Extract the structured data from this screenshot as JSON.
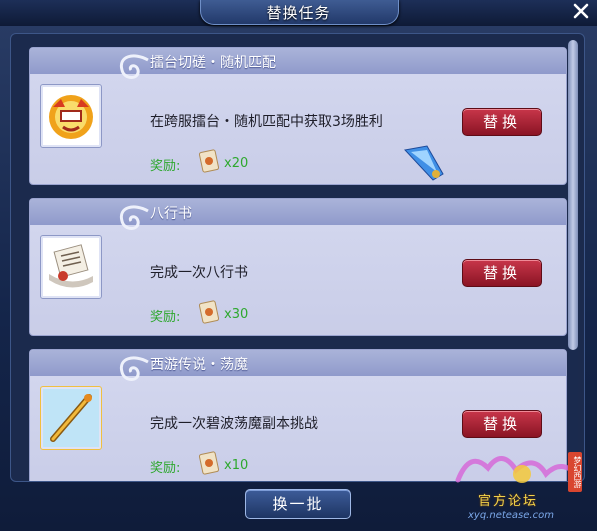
{
  "window": {
    "title": "替换任务"
  },
  "tasks": [
    {
      "title": "擂台切磋・随机匹配",
      "description": "在跨服擂台・随机匹配中获取3场胜利",
      "reward_label": "奖励:",
      "reward_count": "x20",
      "button_label": "替换",
      "icon": "gold-mask-icon"
    },
    {
      "title": "八行书",
      "description": "完成一次八行书",
      "reward_label": "奖励:",
      "reward_count": "x30",
      "button_label": "替换",
      "icon": "letter-scroll-icon"
    },
    {
      "title": "西游传说・荡魔",
      "description": "完成一次碧波荡魔副本挑战",
      "reward_label": "奖励:",
      "reward_count": "x10",
      "button_label": "替换",
      "icon": "golden-staff-icon"
    }
  ],
  "footer": {
    "refresh_label": "换一批"
  },
  "watermark": {
    "logo_text": "官方论坛",
    "site": "xyq.netease.com",
    "tag": "梦幻西游"
  },
  "colors": {
    "reward_green": "#2ea82e",
    "button_red": "#a81f33",
    "header_blue": "#8f9acb"
  }
}
